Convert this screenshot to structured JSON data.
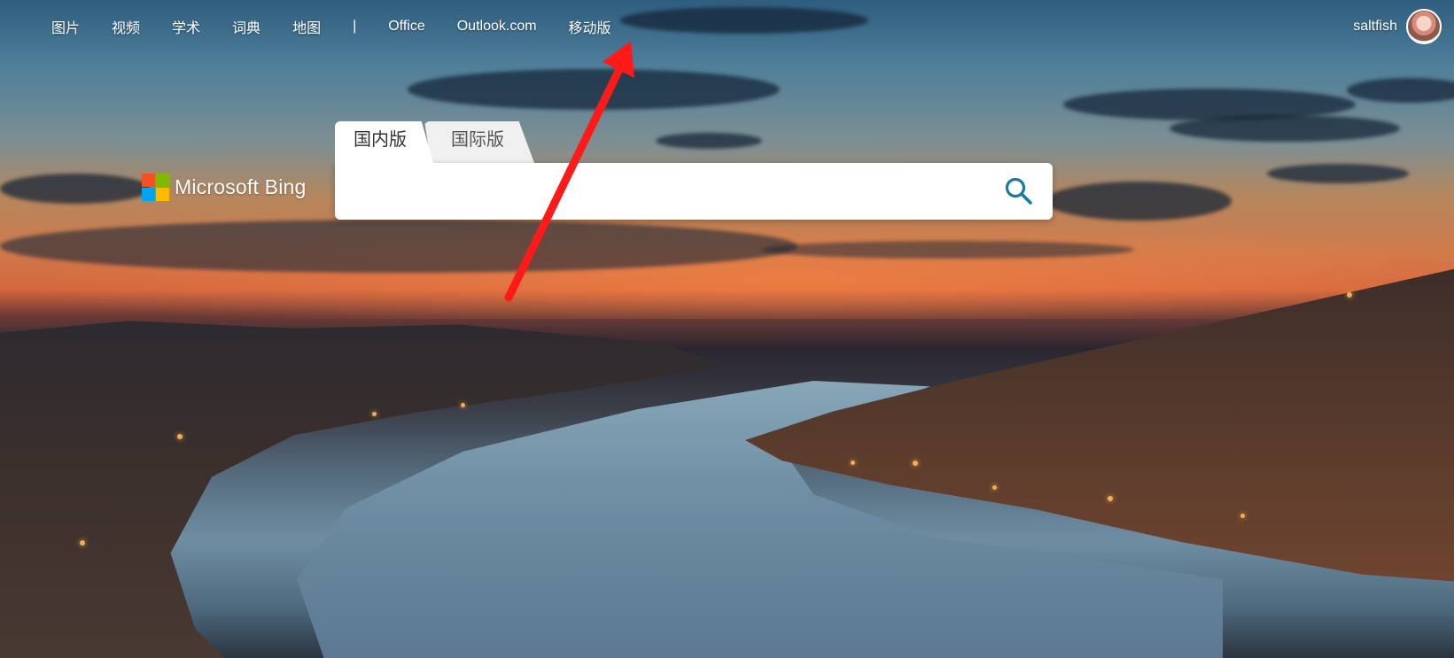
{
  "topnav": {
    "links": [
      {
        "label": "图片"
      },
      {
        "label": "视频"
      },
      {
        "label": "学术"
      },
      {
        "label": "词典"
      },
      {
        "label": "地图"
      }
    ],
    "separator": "|",
    "extra_links": [
      {
        "label": "Office"
      },
      {
        "label": "Outlook.com"
      },
      {
        "label": "移动版"
      }
    ]
  },
  "user": {
    "name": "saltfish",
    "avatar_icon": "avatar-icon"
  },
  "logo": {
    "brand": "Microsoft Bing",
    "colors": [
      "#f25022",
      "#7fba00",
      "#00a4ef",
      "#ffb900"
    ]
  },
  "search": {
    "tabs": [
      {
        "label": "国内版",
        "active": true
      },
      {
        "label": "国际版",
        "active": false
      }
    ],
    "value": "",
    "placeholder": "",
    "button_icon": "search-icon",
    "icon_color": "#1b7aa0"
  },
  "annotation": {
    "color": "#ff1a1a",
    "target": "移动版"
  }
}
